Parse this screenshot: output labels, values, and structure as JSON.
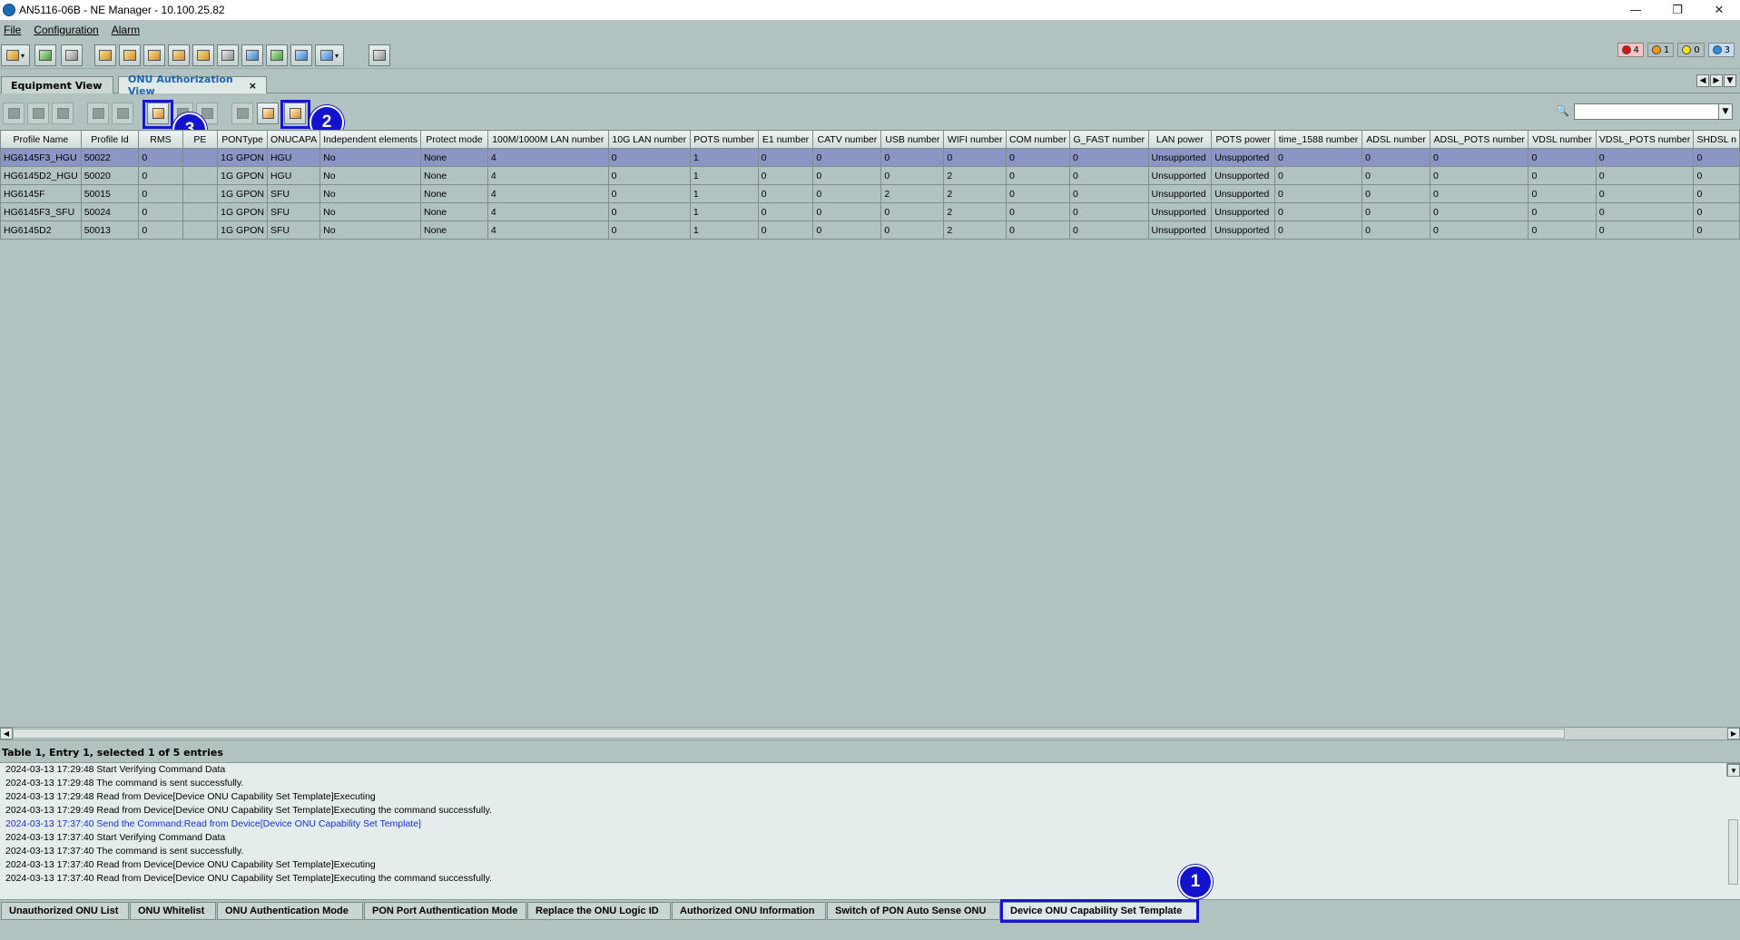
{
  "window": {
    "title": "AN5116-06B - NE Manager - 10.100.25.82",
    "minimize_glyph": "—",
    "maximize_glyph": "❐",
    "close_glyph": "✕"
  },
  "menu": [
    "File",
    "Configuration",
    "Alarm"
  ],
  "alarms": [
    {
      "color": "#e01010",
      "count": "4"
    },
    {
      "color": "#f59a10",
      "count": "1"
    },
    {
      "color": "#f4e020",
      "count": "0"
    },
    {
      "color": "#2a8de0",
      "count": "3"
    }
  ],
  "view_tabs": [
    {
      "label": "Equipment View"
    },
    {
      "label": "ONU Authorization View",
      "close": "×"
    }
  ],
  "search": {
    "value": "",
    "placeholder": ""
  },
  "callouts": [
    "1",
    "2",
    "3"
  ],
  "table": {
    "columns": [
      "Profile Name",
      "Profile Id",
      "RMS",
      "PE",
      "PONType",
      "ONUCAPA",
      "Independent elements",
      "Protect mode",
      "100M/1000M LAN number",
      "10G LAN number",
      "POTS number",
      "E1 number",
      "CATV number",
      "USB number",
      "WIFI number",
      "COM number",
      "G_FAST number",
      "LAN power",
      "POTS power",
      "time_1588 number",
      "ADSL number",
      "ADSL_POTS number",
      "VDSL number",
      "VDSL_POTS number",
      "SHDSL n"
    ],
    "rows": [
      [
        "HG6145F3_HGU",
        "50022",
        "0",
        "",
        "1G GPON",
        "HGU",
        "No",
        "None",
        "4",
        "0",
        "1",
        "0",
        "0",
        "0",
        "0",
        "0",
        "0",
        "Unsupported",
        "Unsupported",
        "0",
        "0",
        "0",
        "0",
        "0",
        "0"
      ],
      [
        "HG6145D2_HGU",
        "50020",
        "0",
        "",
        "1G GPON",
        "HGU",
        "No",
        "None",
        "4",
        "0",
        "1",
        "0",
        "0",
        "0",
        "2",
        "0",
        "0",
        "Unsupported",
        "Unsupported",
        "0",
        "0",
        "0",
        "0",
        "0",
        "0"
      ],
      [
        "HG6145F",
        "50015",
        "0",
        "",
        "1G GPON",
        "SFU",
        "No",
        "None",
        "4",
        "0",
        "1",
        "0",
        "0",
        "2",
        "2",
        "0",
        "0",
        "Unsupported",
        "Unsupported",
        "0",
        "0",
        "0",
        "0",
        "0",
        "0"
      ],
      [
        "HG6145F3_SFU",
        "50024",
        "0",
        "",
        "1G GPON",
        "SFU",
        "No",
        "None",
        "4",
        "0",
        "1",
        "0",
        "0",
        "0",
        "2",
        "0",
        "0",
        "Unsupported",
        "Unsupported",
        "0",
        "0",
        "0",
        "0",
        "0",
        "0"
      ],
      [
        "HG6145D2",
        "50013",
        "0",
        "",
        "1G GPON",
        "SFU",
        "No",
        "None",
        "4",
        "0",
        "1",
        "0",
        "0",
        "0",
        "2",
        "0",
        "0",
        "Unsupported",
        "Unsupported",
        "0",
        "0",
        "0",
        "0",
        "0",
        "0"
      ]
    ],
    "selected_row": 0
  },
  "status_text": "Table 1, Entry 1, selected 1 of 5 entries",
  "log": [
    {
      "text": "2024-03-13 17:29:48 Start Verifying Command Data",
      "blue": false
    },
    {
      "text": "2024-03-13 17:29:48 The command is sent successfully.",
      "blue": false
    },
    {
      "text": "2024-03-13 17:29:48 Read from Device[Device ONU Capability Set Template]Executing",
      "blue": false
    },
    {
      "text": "2024-03-13 17:29:49 Read from Device[Device ONU Capability Set Template]Executing the command successfully.",
      "blue": false
    },
    {
      "text": "2024-03-13 17:37:40 Send the Command:Read from Device[Device ONU Capability Set Template]",
      "blue": true
    },
    {
      "text": "2024-03-13 17:37:40 Start Verifying Command Data",
      "blue": false
    },
    {
      "text": "2024-03-13 17:37:40 The command is sent successfully.",
      "blue": false
    },
    {
      "text": "2024-03-13 17:37:40 Read from Device[Device ONU Capability Set Template]Executing",
      "blue": false
    },
    {
      "text": "2024-03-13 17:37:40 Read from Device[Device ONU Capability Set Template]Executing the command successfully.",
      "blue": false
    }
  ],
  "bottom_tabs": [
    "Unauthorized ONU List",
    "ONU Whitelist",
    "ONU Authentication Mode",
    "PON Port Authentication Mode",
    "Replace the ONU Logic ID",
    "Authorized ONU Information",
    "Switch of PON Auto Sense ONU",
    "Device ONU Capability Set Template"
  ],
  "active_bottom_tab": 7,
  "colors": {
    "highlight": "#1515d8",
    "badge": "#1212cf",
    "selected_row": "#8d95c5"
  }
}
